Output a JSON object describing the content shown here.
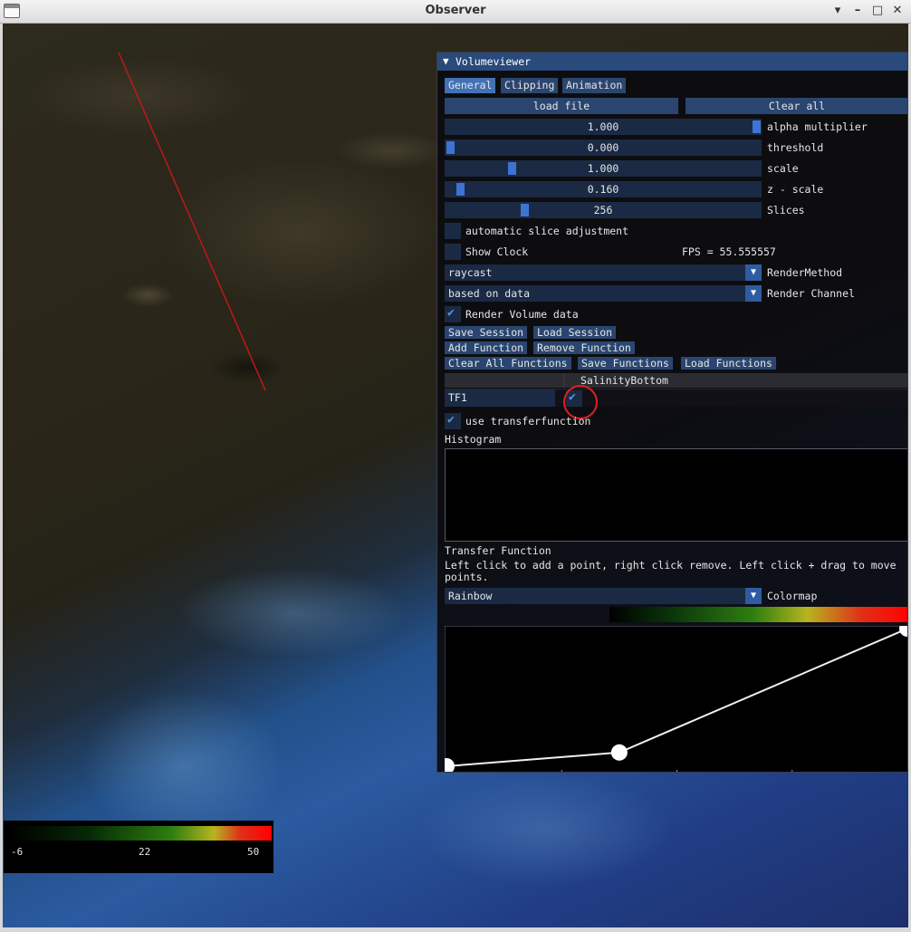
{
  "window": {
    "title": "Observer"
  },
  "legend": {
    "min": "-6",
    "mid": "22",
    "max": "50"
  },
  "panel": {
    "title": "Volumeviewer",
    "tabs": [
      "General",
      "Clipping",
      "Animation"
    ],
    "load_file": "load file",
    "clear_all": "Clear all",
    "sliders": [
      {
        "value": "1.000",
        "label": "alpha multiplier",
        "fraction": 1.0
      },
      {
        "value": "0.000",
        "label": "threshold",
        "fraction": 0.0
      },
      {
        "value": "1.000",
        "label": "scale",
        "fraction": 0.2
      },
      {
        "value": "0.160",
        "label": "z - scale",
        "fraction": 0.04
      },
      {
        "value": "256",
        "label": "Slices",
        "fraction": 0.25
      }
    ],
    "auto_slice": {
      "label": "automatic slice adjustment",
      "checked": false
    },
    "show_clock": {
      "label": "Show Clock",
      "checked": false
    },
    "fps": "FPS = 55.555557",
    "render_method": {
      "value": "raycast",
      "label": "RenderMethod"
    },
    "render_channel": {
      "value": "based on data",
      "label": "Render Channel"
    },
    "render_volume": {
      "label": "Render Volume data",
      "checked": true
    },
    "session_buttons": [
      "Save Session",
      "Load Session"
    ],
    "function_buttons": [
      "Add Function",
      "Remove Function"
    ],
    "function_buttons2": [
      "Clear All Functions",
      "Save Functions",
      "Load Functions"
    ],
    "table": {
      "column": "SalinityBottom",
      "row_name": "TF1",
      "row_checked": true
    },
    "use_tf": {
      "label": "use transferfunction",
      "checked": true
    },
    "histogram_label": "Histogram",
    "tf_label": "Transfer Function",
    "tf_help": "Left click to add a point, right click remove. Left click + drag to move points.",
    "colormap": {
      "value": "Rainbow",
      "label": "Colormap"
    }
  },
  "chart_data": {
    "type": "line",
    "x": [
      0.0,
      0.375,
      1.0
    ],
    "y": [
      0.0,
      0.1,
      1.0
    ],
    "xlim": [
      0,
      1
    ],
    "ylim": [
      0,
      1
    ]
  }
}
